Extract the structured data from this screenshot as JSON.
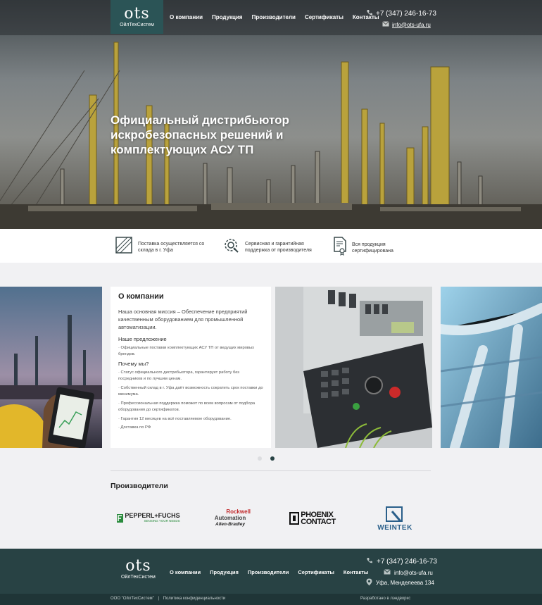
{
  "header": {
    "logo_mark": "ots",
    "logo_sub": "ОйлТехСистем",
    "nav": [
      "О компании",
      "Продукция",
      "Производители",
      "Сертификаты",
      "Контакты"
    ],
    "phone": "+7 (347) 246-16-73",
    "email": "info@ots-ufa.ru"
  },
  "hero": {
    "title": "Официальный дистрибьютор искробезопасных решений и комплектующих АСУ ТП"
  },
  "features": [
    {
      "icon": "box-icon",
      "text_1": "Поставка осуществляется со",
      "text_2": "склада в г. Уфа"
    },
    {
      "icon": "gear-wrench-icon",
      "text_1": "Сервисная и гарантийная",
      "text_2": "поддержка от производителя"
    },
    {
      "icon": "certificate-icon",
      "text_1": "Вся продукция",
      "text_2": "сертифицирована"
    }
  ],
  "about": {
    "title": "О компании",
    "mission": "Наша основная миссия – Обеспечение предприятий качественным оборудованием для промышленной автоматизации.",
    "offer_title": "Наше предложение",
    "offer_items": [
      "Официальные поставки комплектующих АСУ ТП от ведущих мировых брендов."
    ],
    "why_title": "Почему мы?",
    "why_items": [
      "Статус официального дистрибьютора, гарантирует работу без посредников и по лучшим ценам.",
      "Собственный склад в г. Уфа даёт возможность сократить срок поставки до минимума.",
      "Профессиональная поддержка поможет по всем вопросам от подбора оборудования до сертификатов.",
      "Гарантия 12 месяцев на всё поставляемое оборудование.",
      "Доставка по РФ"
    ]
  },
  "slider": {
    "count": 2,
    "active": 2
  },
  "makers": {
    "title": "Производители",
    "brands": [
      {
        "name": "pepperl-fuchs",
        "line1": "PEPPERL+FUCHS",
        "line2": "SENSING YOUR NEEDS"
      },
      {
        "name": "rockwell",
        "line1": "Rockwell",
        "line2": "Automation",
        "line3": "Allen-Bradley"
      },
      {
        "name": "phoenix-contact",
        "line1": "PHOENIX",
        "line2": "CONTACT"
      },
      {
        "name": "weintek",
        "line1": "WEINTEK"
      }
    ]
  },
  "footer": {
    "logo_mark": "ots",
    "logo_sub": "ОйлТехСистем",
    "nav": [
      "О компании",
      "Продукция",
      "Производители",
      "Сертификаты",
      "Контакты"
    ],
    "phone": "+7 (347) 246-16-73",
    "email": "info@ots-ufa.ru",
    "address": "Уфа, Менделеева 134",
    "copyright": "ООО \"ОйлТехСистем\"",
    "separator": "|",
    "privacy": "Политика конфиденциальности",
    "developer": "Разработано в лэндворкс"
  },
  "colors": {
    "accent": "#2b5456",
    "footer": "#284244",
    "bottom_bar": "#1f3537"
  }
}
